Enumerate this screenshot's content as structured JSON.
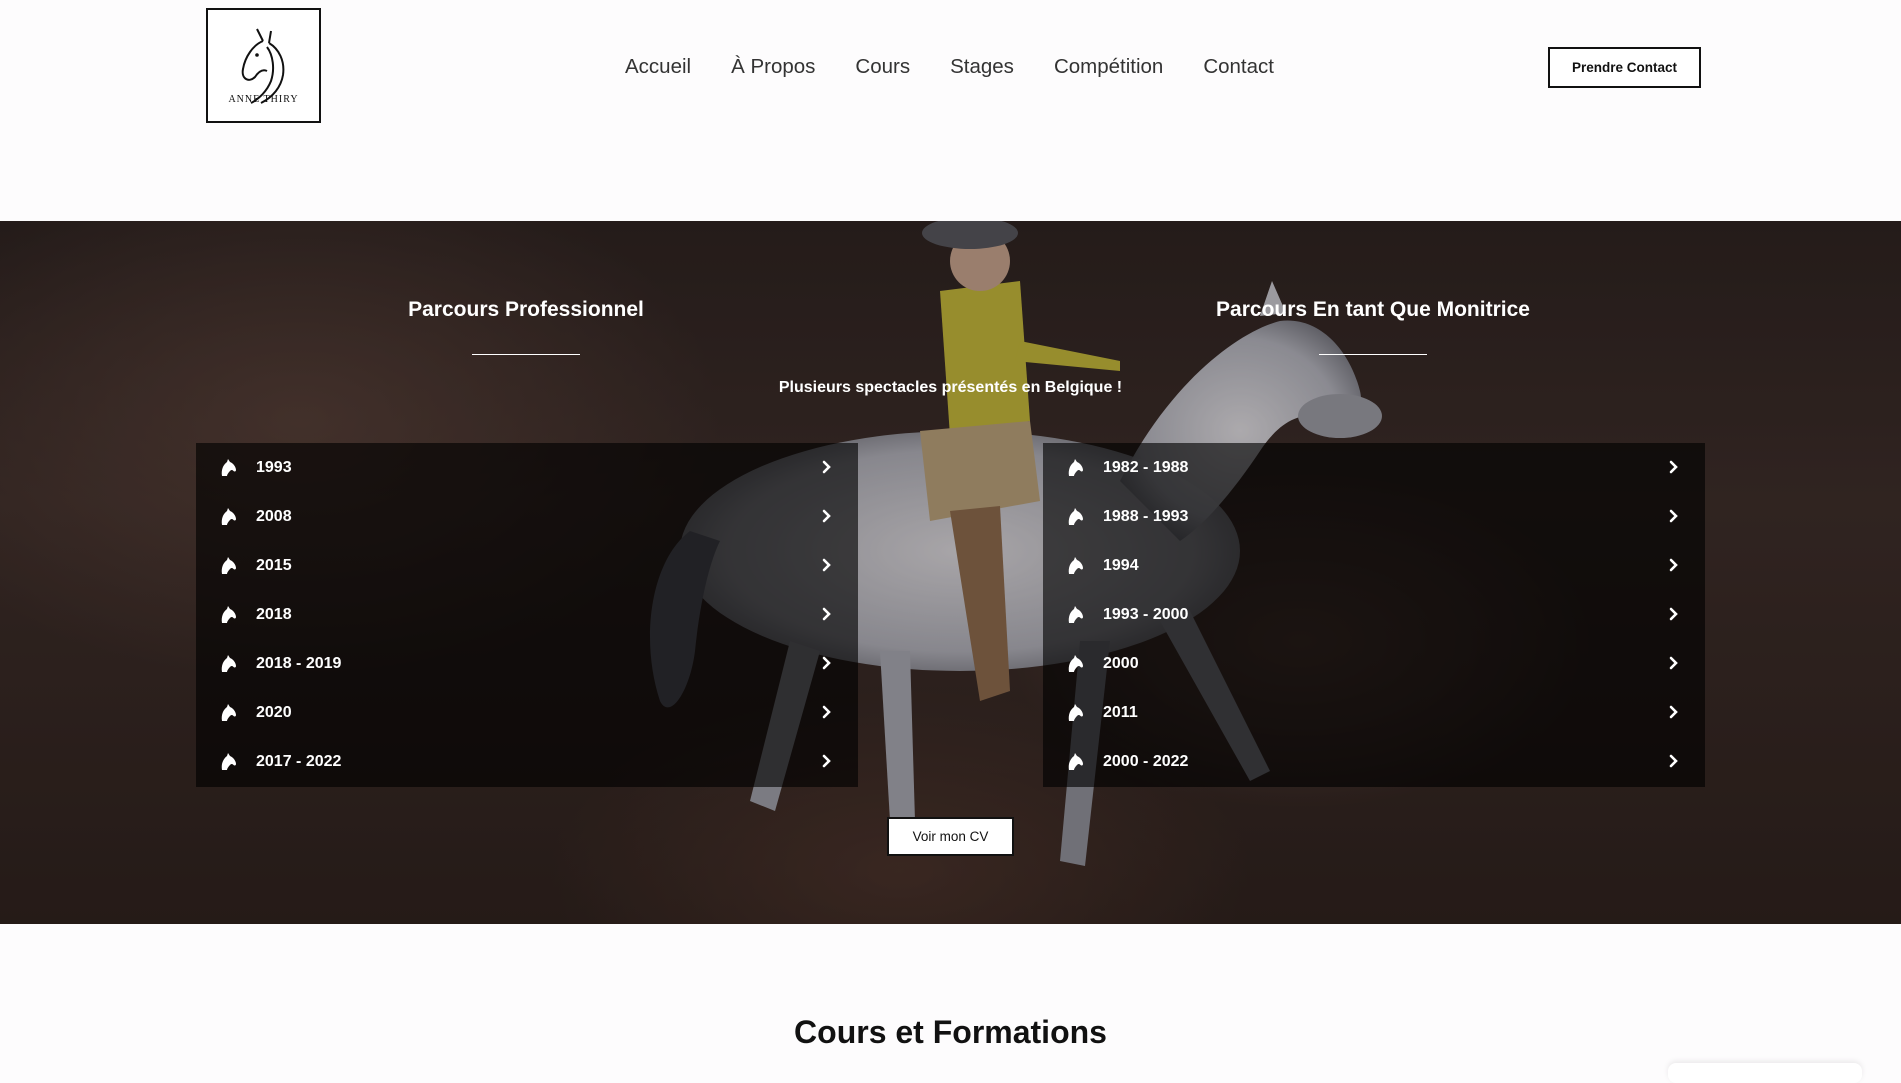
{
  "header": {
    "logo_text": "ANNE THIRY",
    "nav": [
      "Accueil",
      "À Propos",
      "Cours",
      "Stages",
      "Compétition",
      "Contact"
    ],
    "contact_button": "Prendre Contact"
  },
  "hero": {
    "left_title": "Parcours Professionnel",
    "right_title": "Parcours En tant Que Monitrice",
    "subtitle": "Plusieurs spectacles présentés en Belgique !",
    "left_items": [
      "1993",
      "2008",
      "2015",
      "2018",
      "2018 - 2019",
      "2020",
      "2017 - 2022"
    ],
    "right_items": [
      "1982 - 1988",
      "1988 - 1993",
      "1994",
      "1993 - 2000",
      "2000",
      "2011",
      "2000 - 2022"
    ],
    "item_icon": "horse-head-icon",
    "chevron_icon": "chevron-right-icon",
    "cv_button": "Voir mon CV"
  },
  "section": {
    "title": "Cours et Formations"
  },
  "colors": {
    "background": "#fdfcfd",
    "panel": "rgba(0,0,0,0.62)",
    "text_light": "#ffffff",
    "text_dark": "#111111"
  }
}
